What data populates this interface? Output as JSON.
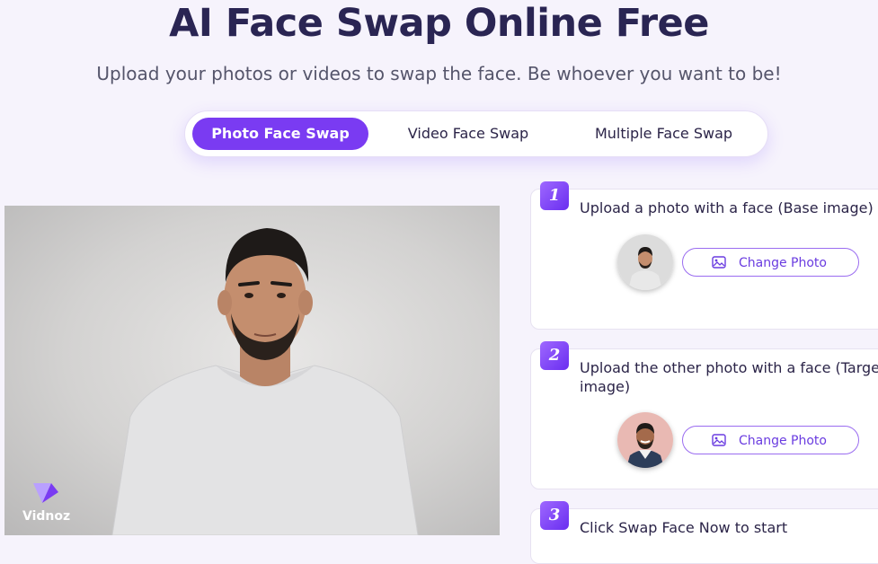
{
  "header": {
    "title": "AI Face Swap Online Free",
    "subtitle": "Upload your photos or videos to swap the face. Be whoever you want to be!"
  },
  "tabs": [
    {
      "label": "Photo Face Swap",
      "active": true
    },
    {
      "label": "Video Face Swap",
      "active": false
    },
    {
      "label": "Multiple Face Swap",
      "active": false
    }
  ],
  "preview": {
    "watermark": "Vidnoz"
  },
  "steps": [
    {
      "number": "1",
      "text": "Upload a photo with a face (Base image)",
      "button": "Change Photo"
    },
    {
      "number": "2",
      "text": "Upload the other photo with a face (Target image)",
      "button": "Change Photo"
    },
    {
      "number": "3",
      "text": "Click Swap Face Now to start"
    }
  ],
  "colors": {
    "accent": "#7a3bf2",
    "background": "#f6f3fc",
    "title": "#2a2553"
  }
}
